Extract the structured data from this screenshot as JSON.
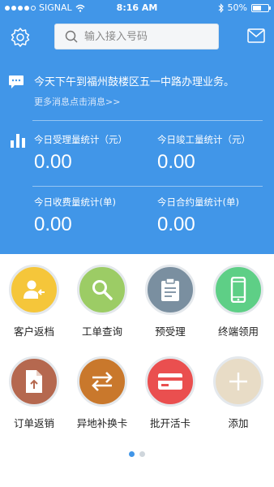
{
  "status_bar": {
    "carrier": "SIGNAL",
    "time": "8:16 AM",
    "battery": "50%",
    "battery_level": 0.5
  },
  "header": {
    "search": {
      "placeholder": "输入接入号码"
    }
  },
  "message": {
    "text": "今天下午到福州鼓楼区五一中路办理业务。",
    "more": "更多消息点击消息>>"
  },
  "stats": [
    {
      "label": "今日受理量统计（元）",
      "value": "0.00"
    },
    {
      "label": "今日竣工量统计（元）",
      "value": "0.00"
    },
    {
      "label": "今日收费量统计(单)",
      "value": "0.00"
    },
    {
      "label": "今日合约量统计(单)",
      "value": "0.00"
    }
  ],
  "grid": [
    {
      "label": "客户返档",
      "icon": "customer-return-icon",
      "color": "#f5c63a"
    },
    {
      "label": "工单查询",
      "icon": "search-icon",
      "color": "#9ccc65"
    },
    {
      "label": "预受理",
      "icon": "clipboard-icon",
      "color": "#7a8fa0"
    },
    {
      "label": "终端领用",
      "icon": "phone-icon",
      "color": "#5ecf86"
    },
    {
      "label": "订单返销",
      "icon": "document-return-icon",
      "color": "#b5684f"
    },
    {
      "label": "异地补换卡",
      "icon": "exchange-icon",
      "color": "#c9782c"
    },
    {
      "label": "批开活卡",
      "icon": "card-icon",
      "color": "#ea4f4f"
    },
    {
      "label": "添加",
      "icon": "plus-icon",
      "color": "#e8dcc6"
    }
  ],
  "pager": {
    "pages": 2,
    "active": 1
  },
  "colors": {
    "primary": "#4196e8"
  }
}
